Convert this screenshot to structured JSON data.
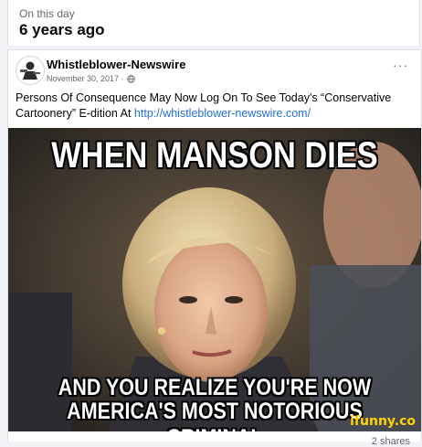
{
  "on_this_day": {
    "label": "On this day",
    "years_ago": "6 years ago"
  },
  "post": {
    "author": "Whistleblower-Newswire",
    "date": "November 30, 2017 ·",
    "privacy_icon": "globe-icon",
    "more_label": "···",
    "text_prefix": "Persons Of Consequence May Now Log On To See Today's “Conservative Cartoonery” E-dition At ",
    "link": "http://whistleblower-newswire.com/",
    "image": {
      "top_caption": "WHEN MANSON DIES",
      "bottom_caption_line1": "AND YOU REALIZE YOU'RE NOW",
      "bottom_caption_line2": "AMERICA'S MOST NOTORIOUS CRIMINAL",
      "watermark": "ifunny.co"
    },
    "shares": "2 shares"
  },
  "colors": {
    "background": "#f0f2f5",
    "card": "#ffffff",
    "link": "#216fdb",
    "secondary_text": "#65676b",
    "watermark": "#ffd200"
  }
}
